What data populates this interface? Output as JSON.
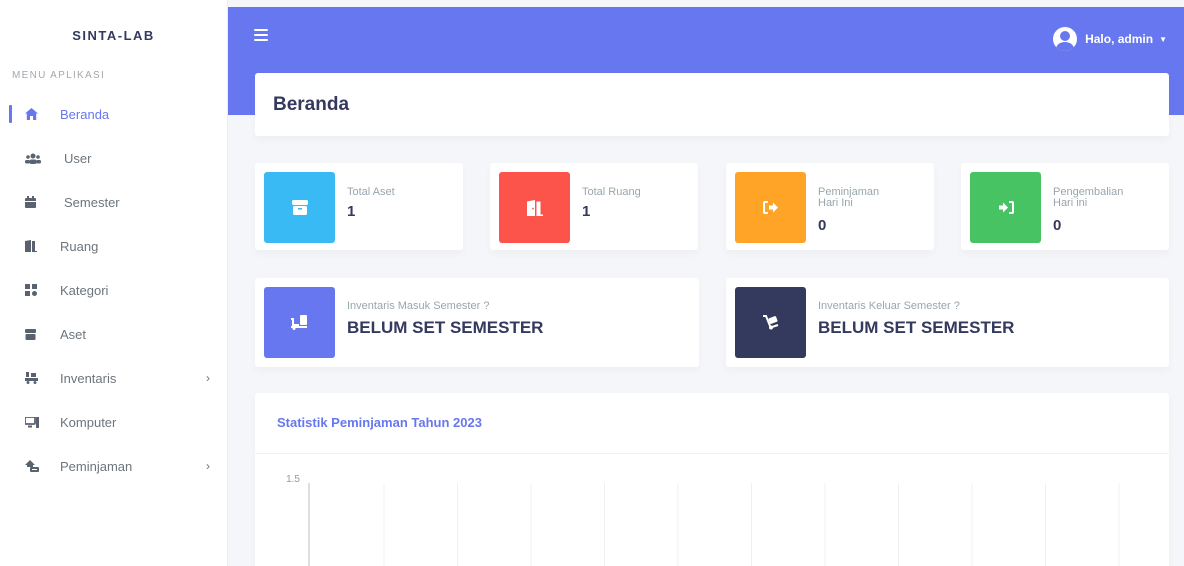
{
  "brand": "SINTA-LAB",
  "menu_header": "MENU APLIKASI",
  "menu": [
    {
      "label": "Beranda",
      "icon": "home-icon",
      "active": true,
      "chevron": false
    },
    {
      "label": "User",
      "icon": "users-icon",
      "active": false,
      "chevron": false
    },
    {
      "label": "Semester",
      "icon": "calendar-icon",
      "active": false,
      "chevron": false
    },
    {
      "label": "Ruang",
      "icon": "door-icon",
      "active": false,
      "chevron": false
    },
    {
      "label": "Kategori",
      "icon": "categories-icon",
      "active": false,
      "chevron": false
    },
    {
      "label": "Aset",
      "icon": "box-icon",
      "active": false,
      "chevron": false
    },
    {
      "label": "Inventaris",
      "icon": "dolly-icon",
      "active": false,
      "chevron": true
    },
    {
      "label": "Komputer",
      "icon": "computer-icon",
      "active": false,
      "chevron": false
    },
    {
      "label": "Peminjaman",
      "icon": "handshake-icon",
      "active": false,
      "chevron": true
    }
  ],
  "topbar": {
    "user_greeting": "Halo, admin"
  },
  "page_title": "Beranda",
  "stats": [
    {
      "label": "Total Aset",
      "value": "1",
      "color": "#3abaf4",
      "icon": "box-icon"
    },
    {
      "label": "Total Ruang",
      "value": "1",
      "color": "#fc544b",
      "icon": "door-icon"
    },
    {
      "label": "Peminjaman\nHari Ini",
      "value": "0",
      "color": "#ffa426",
      "icon": "sign-out-icon"
    },
    {
      "label": "Pengembalian\nHari ini",
      "value": "0",
      "color": "#47c363",
      "icon": "sign-in-icon"
    }
  ],
  "inventory": [
    {
      "label": "Inventaris Masuk Semester ?",
      "value": "BELUM SET SEMESTER",
      "color": "#6777ef",
      "icon": "dolly-in-icon"
    },
    {
      "label": "Inventaris Keluar Semester ?",
      "value": "BELUM SET SEMESTER",
      "color": "#34395e",
      "icon": "dolly-out-icon"
    }
  ],
  "chart": {
    "title": "Statistik Peminjaman Tahun 2023"
  },
  "chart_data": {
    "type": "bar",
    "title": "Statistik Peminjaman Tahun 2023",
    "y_ticks": [
      "1.5"
    ],
    "grid": true
  }
}
